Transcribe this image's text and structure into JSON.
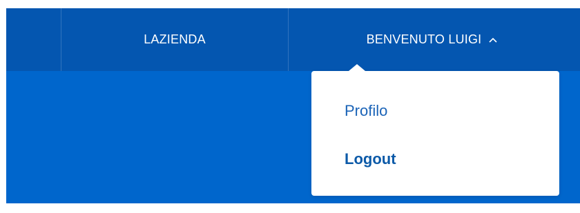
{
  "nav": {
    "company_label": "LAZIENDA",
    "user_label": "BENVENUTO LUIGI",
    "user_chevron_icon": "chevron-up-icon"
  },
  "dropdown": {
    "items": [
      {
        "label": "Profilo"
      },
      {
        "label": "Logout"
      }
    ]
  },
  "colors": {
    "topbar": "#0456b0",
    "subbar": "#0066cc",
    "menu_text": "#1a63b7"
  }
}
